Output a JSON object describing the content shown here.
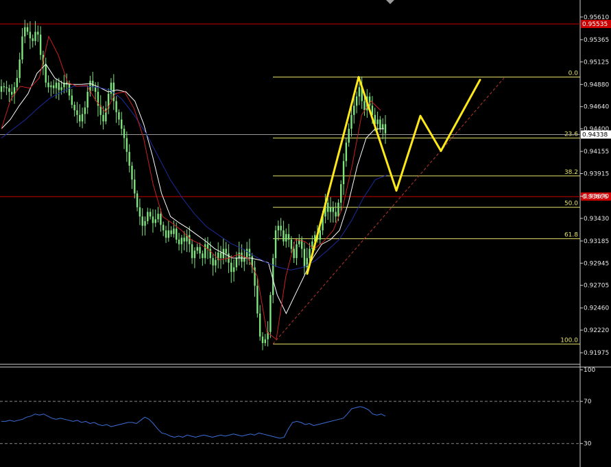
{
  "chart_data": {
    "type": "candlestick",
    "title": "",
    "price_axis": {
      "ylim": [
        0.9185,
        0.9575
      ],
      "tick_labels": [
        "0.95610",
        "0.95365",
        "0.95125",
        "0.94880",
        "0.94640",
        "0.94400",
        "0.94155",
        "0.93915",
        "0.93670",
        "0.93430",
        "0.93185",
        "0.92945",
        "0.92705",
        "0.92460",
        "0.92220",
        "0.91975"
      ]
    },
    "current_price_label": "0.94338",
    "price_lines": [
      {
        "label": "0.95535",
        "value": 0.95535,
        "color": "#cc0000"
      },
      {
        "label": "0.93666",
        "value": 0.93666,
        "color": "#cc0000"
      }
    ],
    "bid_line": {
      "value": 0.94338,
      "color": "#9a9a9a"
    },
    "fibonacci": {
      "color": "#e8e26a",
      "levels": [
        {
          "label": "0.0",
          "value": 0.9496
        },
        {
          "label": "23.6",
          "value": 0.943
        },
        {
          "label": "38.2",
          "value": 0.9389
        },
        {
          "label": "50.0",
          "value": 0.9355
        },
        {
          "label": "61.8",
          "value": 0.9321
        },
        {
          "label": "100.0",
          "value": 0.9207
        }
      ]
    },
    "candles": {
      "color": "#7ee57e",
      "close": [
        0.9486,
        0.9485,
        0.9484,
        0.948,
        0.9477,
        0.9485,
        0.9495,
        0.9515,
        0.954,
        0.955,
        0.9545,
        0.9538,
        0.9535,
        0.9545,
        0.9542,
        0.952,
        0.951,
        0.949,
        0.9485,
        0.9487,
        0.9484,
        0.949,
        0.9482,
        0.9485,
        0.949,
        0.9488,
        0.9476,
        0.9466,
        0.946,
        0.9455,
        0.9448,
        0.9456,
        0.9463,
        0.948,
        0.9492,
        0.9485,
        0.948,
        0.9465,
        0.9455,
        0.9448,
        0.9462,
        0.9478,
        0.949,
        0.947,
        0.9458,
        0.945,
        0.944,
        0.943,
        0.9415,
        0.94,
        0.9385,
        0.937,
        0.9355,
        0.9345,
        0.9335,
        0.934,
        0.935,
        0.9345,
        0.9338,
        0.9342,
        0.9348,
        0.9336,
        0.933,
        0.9322,
        0.933,
        0.9326,
        0.9332,
        0.932,
        0.9315,
        0.9322,
        0.9318,
        0.9325,
        0.9315,
        0.93,
        0.9308,
        0.9312,
        0.9305,
        0.93,
        0.9315,
        0.931,
        0.93,
        0.9292,
        0.9298,
        0.9306,
        0.93,
        0.931,
        0.9305,
        0.9295,
        0.9285,
        0.929,
        0.93,
        0.9306,
        0.9296,
        0.93,
        0.931,
        0.9302,
        0.929,
        0.927,
        0.924,
        0.9215,
        0.9208,
        0.9212,
        0.922,
        0.926,
        0.93,
        0.933,
        0.9335,
        0.933,
        0.9318,
        0.9326,
        0.932,
        0.931,
        0.93,
        0.9315,
        0.932,
        0.931,
        0.929,
        0.93,
        0.931,
        0.9318,
        0.9325,
        0.932,
        0.933,
        0.9345,
        0.936,
        0.935,
        0.9355,
        0.935,
        0.9345,
        0.936,
        0.938,
        0.9405,
        0.9425,
        0.944,
        0.9455,
        0.9465,
        0.9475,
        0.9485,
        0.947,
        0.946,
        0.9475,
        0.9465,
        0.9455,
        0.9445,
        0.945,
        0.944,
        0.9445,
        0.9435
      ]
    },
    "moving_averages": [
      {
        "color": "#ffffff",
        "values": [
          0.944,
          0.945,
          0.9465,
          0.9478,
          0.95,
          0.951,
          0.9495,
          0.9489,
          0.9488,
          0.9488,
          0.9489,
          0.9485,
          0.948,
          0.9482,
          0.948,
          0.947,
          0.9445,
          0.941,
          0.937,
          0.9345,
          0.9338,
          0.9332,
          0.9325,
          0.9318,
          0.931,
          0.9305,
          0.93,
          0.93,
          0.93,
          0.9298,
          0.9295,
          0.926,
          0.924,
          0.926,
          0.928,
          0.93,
          0.9315,
          0.932,
          0.933,
          0.936,
          0.94,
          0.943,
          0.944,
          0.944
        ]
      },
      {
        "color": "#1c2b9c",
        "values": [
          0.943,
          0.944,
          0.945,
          0.9462,
          0.9473,
          0.948,
          0.9486,
          0.9486,
          0.9485,
          0.9482,
          0.9472,
          0.9455,
          0.9435,
          0.941,
          0.9385,
          0.9365,
          0.9348,
          0.9334,
          0.9325,
          0.9316,
          0.931,
          0.9302,
          0.9295,
          0.929,
          0.9287,
          0.929,
          0.9297,
          0.9308,
          0.932,
          0.934,
          0.9365,
          0.9385,
          0.939
        ]
      },
      {
        "color": "#cc2020",
        "values": [
          0.944,
          0.9472,
          0.9486,
          0.9484,
          0.9495,
          0.954,
          0.952,
          0.949,
          0.9486,
          0.9487,
          0.947,
          0.9458,
          0.9478,
          0.948,
          0.9462,
          0.943,
          0.938,
          0.9345,
          0.9338,
          0.933,
          0.932,
          0.9315,
          0.9308,
          0.9298,
          0.93,
          0.9304,
          0.93,
          0.928,
          0.922,
          0.9212,
          0.928,
          0.932,
          0.9318,
          0.931,
          0.9318,
          0.933,
          0.9355,
          0.94,
          0.9455,
          0.947,
          0.946
        ]
      }
    ],
    "projection_path": {
      "color": "#ffe81a",
      "points": [
        [
          0,
          0.9283
        ],
        [
          1,
          0.9496
        ],
        [
          2,
          0.9373
        ],
        [
          3,
          0.9454
        ],
        [
          4,
          0.9416
        ],
        [
          5,
          0.9493
        ]
      ]
    },
    "trendline": {
      "color": "#b83a2a",
      "style": "dashed",
      "from": 0.9207,
      "to": 0.9495
    },
    "indicator": {
      "type": "rsi",
      "color": "#3b6fd8",
      "tick_labels": [
        "100",
        "70",
        "30"
      ],
      "levels": [
        70,
        30
      ],
      "ylim": [
        22,
        100
      ],
      "values": [
        51,
        51,
        52,
        51,
        52,
        53,
        55,
        56,
        58,
        57,
        58,
        56,
        54,
        53,
        54,
        53,
        52,
        51,
        52,
        50,
        51,
        49,
        50,
        48,
        47,
        48,
        46,
        47,
        48,
        49,
        50,
        50,
        49,
        52,
        55,
        53,
        49,
        44,
        40,
        39,
        37,
        36,
        37,
        36,
        38,
        37,
        36,
        37,
        38,
        37,
        36,
        37,
        38,
        37,
        38,
        39,
        38,
        37,
        38,
        39,
        38,
        40,
        39,
        38,
        37,
        36,
        35,
        36,
        44,
        50,
        51,
        50,
        48,
        49,
        47,
        48,
        49,
        50,
        51,
        52,
        53,
        54,
        58,
        63,
        64,
        65,
        64,
        62,
        58,
        57,
        58,
        56
      ]
    }
  }
}
